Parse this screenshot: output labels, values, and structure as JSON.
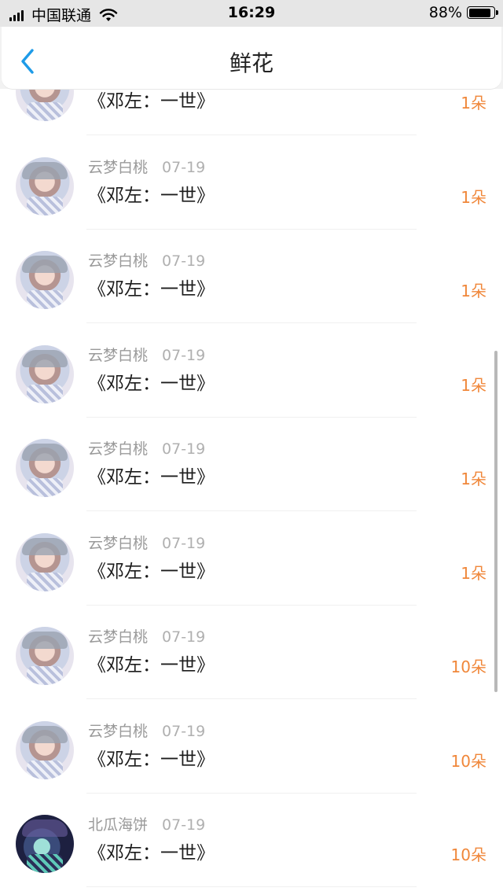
{
  "status_bar": {
    "carrier": "中国联通",
    "time": "16:29",
    "battery": "88%",
    "battery_level": 0.88
  },
  "header": {
    "title": "鲜花",
    "back_icon": "chevron-left-icon",
    "accent_color": "#1e9be8"
  },
  "list": {
    "amount_color": "#f0873a",
    "items": [
      {
        "user": "",
        "date": "",
        "title": "《邓左：一世》",
        "amount": "1朵"
      },
      {
        "user": "云梦白桃",
        "date": "07-19",
        "title": "《邓左：一世》",
        "amount": "1朵"
      },
      {
        "user": "云梦白桃",
        "date": "07-19",
        "title": "《邓左：一世》",
        "amount": "1朵"
      },
      {
        "user": "云梦白桃",
        "date": "07-19",
        "title": "《邓左：一世》",
        "amount": "1朵"
      },
      {
        "user": "云梦白桃",
        "date": "07-19",
        "title": "《邓左：一世》",
        "amount": "1朵"
      },
      {
        "user": "云梦白桃",
        "date": "07-19",
        "title": "《邓左：一世》",
        "amount": "1朵"
      },
      {
        "user": "云梦白桃",
        "date": "07-19",
        "title": "《邓左：一世》",
        "amount": "10朵"
      },
      {
        "user": "云梦白桃",
        "date": "07-19",
        "title": "《邓左：一世》",
        "amount": "10朵"
      },
      {
        "user": "北瓜海饼",
        "date": "07-19",
        "title": "《邓左：一世》",
        "amount": "10朵"
      }
    ]
  }
}
